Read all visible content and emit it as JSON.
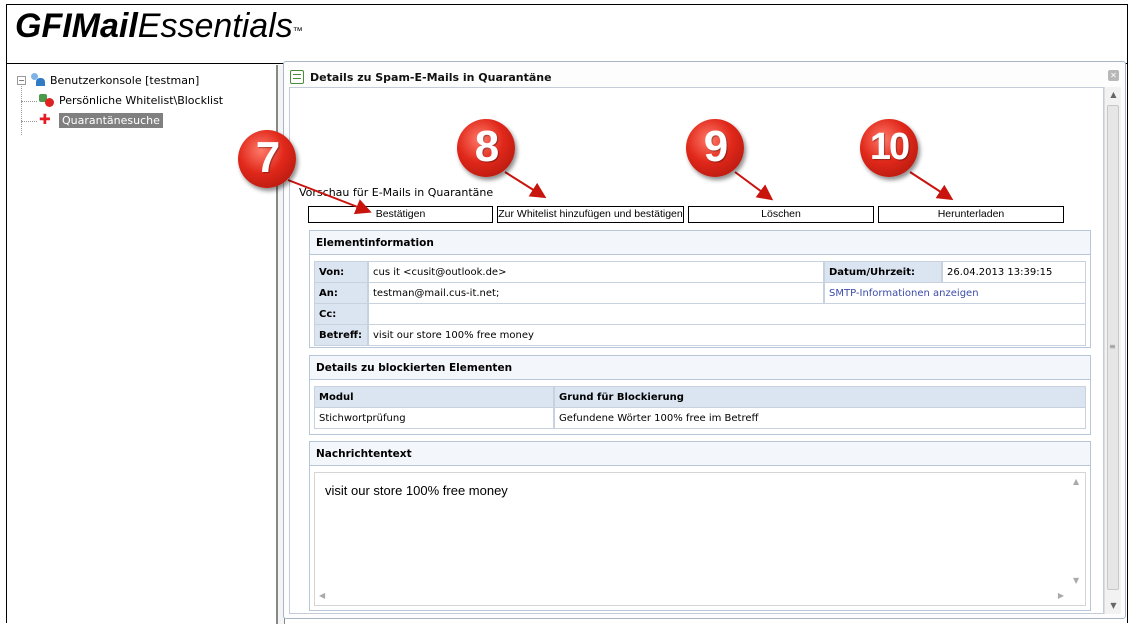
{
  "logo": {
    "gfi": "GFI",
    "mail": "Mail",
    "essentials": "Essentials",
    "tm": "™"
  },
  "tree": {
    "root": "Benutzerkonsole [testman]",
    "items": [
      "Persönliche Whitelist\\Blocklist",
      "Quarantänesuche"
    ]
  },
  "panel": {
    "title": "Details zu Spam-E-Mails in Quarantäne"
  },
  "preview_label": "Vorschau für E-Mails in Quarantäne",
  "buttons": {
    "confirm": "Bestätigen",
    "whitelist": "Zur Whitelist hinzufügen und bestätigen",
    "delete": "Löschen",
    "download": "Herunterladen"
  },
  "element_info": {
    "title": "Elementinformation",
    "from_label": "Von:",
    "from_value": "cus it <cusit@outlook.de>",
    "date_label": "Datum/Uhrzeit:",
    "date_value": "26.04.2013 13:39:15",
    "to_label": "An:",
    "to_value": "testman@mail.cus-it.net;",
    "smtp_link": "SMTP-Informationen anzeigen",
    "cc_label": "Cc:",
    "cc_value": "",
    "subject_label": "Betreff:",
    "subject_value": "visit our store 100% free money"
  },
  "blocked": {
    "title": "Details zu blockierten Elementen",
    "col_module": "Modul",
    "col_reason": "Grund für Blockierung",
    "rows": [
      {
        "module": "Stichwortprüfung",
        "reason": "Gefundene Wörter 100% free im Betreff"
      }
    ]
  },
  "message": {
    "title": "Nachrichtentext",
    "body": "visit our store 100% free money"
  },
  "callouts": [
    "7",
    "8",
    "9",
    "10"
  ],
  "colors": {
    "callout": "#e0281a",
    "accent_red": "#e31b23",
    "label_bg": "#dbe4f1",
    "link": "#3b4ba8"
  }
}
